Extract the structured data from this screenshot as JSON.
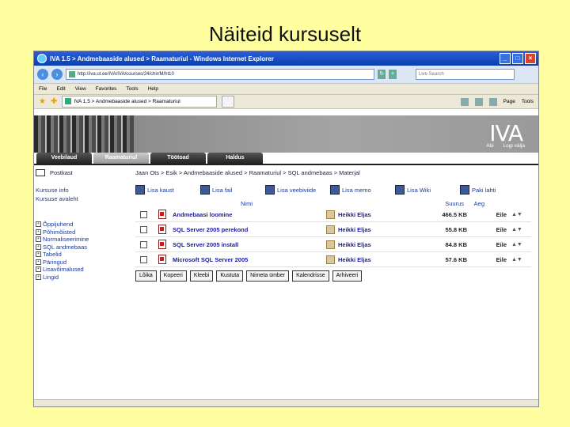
{
  "slide": {
    "title": "Näiteid kursuselt"
  },
  "browser": {
    "title": "IVA 1.5 > Andmebaaside alused > Raamaturiul - Windows Internet Explorer",
    "address": "http://iva.ut.ee/IVA/IVA/courses/24/chir/M/ht10",
    "search_placeholder": "Live Search",
    "menu": [
      "File",
      "Edit",
      "View",
      "Favorites",
      "Tools",
      "Help"
    ],
    "tab": "IVA 1.5 > Andmebaaside alused > Raamaturiul",
    "toolbar_right": [
      "Page",
      "Tools"
    ]
  },
  "site": {
    "logo": "IVA",
    "links": [
      "Abi",
      "Logi välja"
    ],
    "tabs": [
      "Veebilaud",
      "Raamaturiul",
      "Töötoad",
      "Haldus"
    ]
  },
  "sidebar": {
    "postkast": "Postkast",
    "links": [
      "Kursuse info",
      "Kursuse avaleht"
    ],
    "tree": [
      "Õppijuhend",
      "Põhimõisted",
      "Normaliseerimine",
      "SQL andmebaas",
      "Tabelid",
      "Päringud",
      "Lisavõimalused",
      "Lingid"
    ]
  },
  "main": {
    "breadcrumb": "Jaan Ots > Esik > Andmebaaside alused > Raamaturiul > SQL andmebaas > Materjal",
    "actions": [
      "Lisa kaust",
      "Lisa fail",
      "Lisa veebiviide",
      "Lisa memo",
      "Lisa Wiki",
      "Paki lahti"
    ],
    "columns": {
      "name": "Nimi",
      "size": "Suurus",
      "date": "Aeg"
    },
    "rows": [
      {
        "name": "Andmebaasi loomine",
        "author": "Heikki Eljas",
        "size": "466.5 KB",
        "date": "Eile"
      },
      {
        "name": "SQL Server 2005 perekond",
        "author": "Heikki Eljas",
        "size": "55.8 KB",
        "date": "Eile"
      },
      {
        "name": "SQL Server 2005 install",
        "author": "Heikki Eljas",
        "size": "84.8 KB",
        "date": "Eile"
      },
      {
        "name": "Microsoft SQL Server 2005",
        "author": "Heikki Eljas",
        "size": "57.6 KB",
        "date": "Eile"
      }
    ],
    "buttons": [
      "Lõika",
      "Kopeeri",
      "Kleebi",
      "Kustuta",
      "Nimeta ümber",
      "Kalendrisse",
      "Arhiveeri"
    ]
  }
}
